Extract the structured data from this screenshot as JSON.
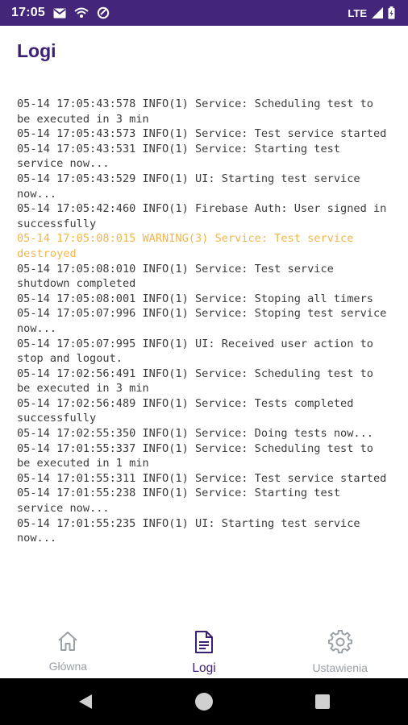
{
  "status_bar": {
    "time": "17:05",
    "network_label": "LTE",
    "icons": [
      "gmail-icon",
      "wifi-calling-icon",
      "data-saver-icon",
      "signal-icon",
      "battery-icon"
    ]
  },
  "page": {
    "title": "Logi"
  },
  "logs": [
    {
      "text": "05-14 17:05:43:578 INFO(1) Service: Scheduling test to be executed in 3 min",
      "level": "info"
    },
    {
      "text": "05-14 17:05:43:573 INFO(1) Service: Test service started",
      "level": "info"
    },
    {
      "text": "05-14 17:05:43:531 INFO(1) Service: Starting test service now...",
      "level": "info"
    },
    {
      "text": "05-14 17:05:43:529 INFO(1) UI: Starting test service now...",
      "level": "info"
    },
    {
      "text": "05-14 17:05:42:460 INFO(1) Firebase Auth: User signed in successfully",
      "level": "info"
    },
    {
      "text": "05-14 17:05:08:015 WARNING(3) Service: Test service destroyed",
      "level": "warning"
    },
    {
      "text": "05-14 17:05:08:010 INFO(1) Service: Test service shutdown completed",
      "level": "info"
    },
    {
      "text": "05-14 17:05:08:001 INFO(1) Service: Stoping all timers",
      "level": "info"
    },
    {
      "text": "05-14 17:05:07:996 INFO(1) Service: Stoping test service now...",
      "level": "info"
    },
    {
      "text": "05-14 17:05:07:995 INFO(1) UI: Received user action to stop and logout.",
      "level": "info"
    },
    {
      "text": "05-14 17:02:56:491 INFO(1) Service: Scheduling test to be executed in 3 min",
      "level": "info"
    },
    {
      "text": "05-14 17:02:56:489 INFO(1) Service: Tests completed successfully",
      "level": "info"
    },
    {
      "text": "05-14 17:02:55:350 INFO(1) Service: Doing tests now...",
      "level": "info"
    },
    {
      "text": "05-14 17:01:55:337 INFO(1) Service: Scheduling test to be executed in 1 min",
      "level": "info"
    },
    {
      "text": "05-14 17:01:55:311 INFO(1) Service: Test service started",
      "level": "info"
    },
    {
      "text": "05-14 17:01:55:238 INFO(1) Service: Starting test service now...",
      "level": "info"
    },
    {
      "text": "05-14 17:01:55:235 INFO(1) UI: Starting test service now...",
      "level": "info"
    }
  ],
  "bottom_nav": {
    "items": [
      {
        "label": "Główna",
        "icon": "home-icon",
        "active": false
      },
      {
        "label": "Logi",
        "icon": "document-icon",
        "active": true
      },
      {
        "label": "Ustawienia",
        "icon": "gear-icon",
        "active": false
      }
    ]
  },
  "system_nav": {
    "icons": [
      "back-icon",
      "home-circle-icon",
      "recents-icon"
    ]
  },
  "colors": {
    "status_bar_bg": "#43267a",
    "title": "#3b1f73",
    "log_text": "#3a3a3a",
    "warning_text": "#f2b64b",
    "nav_inactive": "#9aa0a6",
    "nav_active": "#3b1f73"
  }
}
